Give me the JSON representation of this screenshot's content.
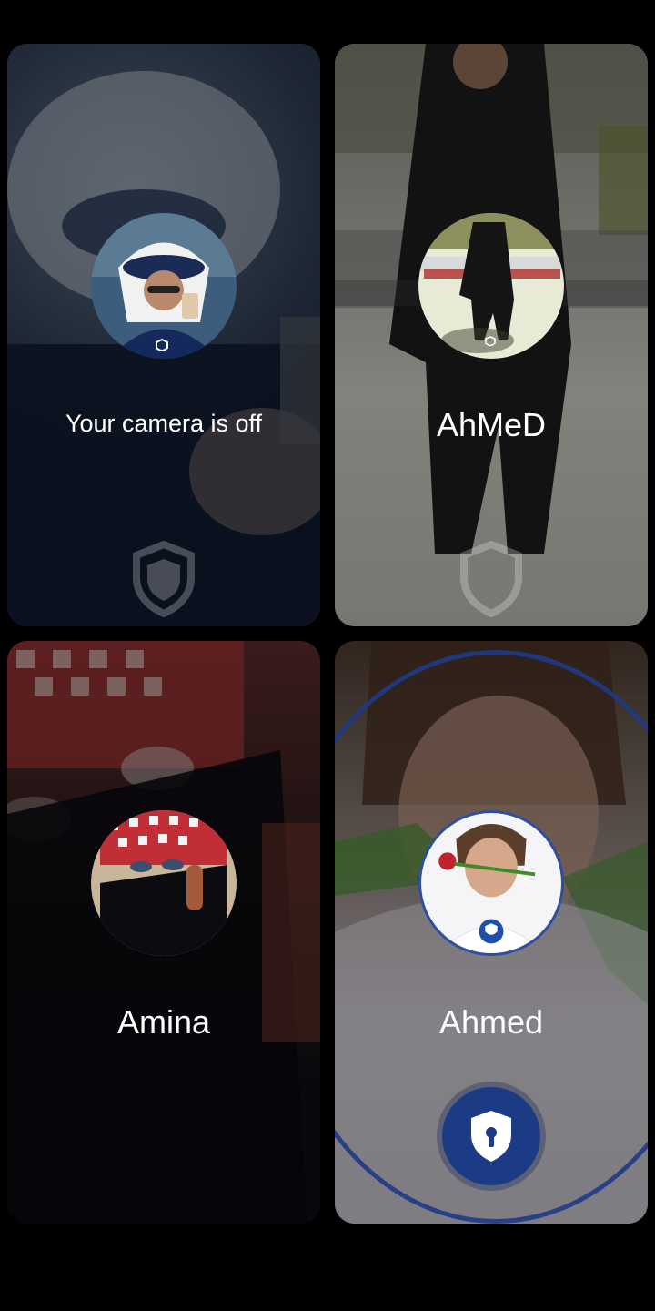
{
  "tiles": [
    {
      "label": "Your camera is off",
      "kind": "self"
    },
    {
      "label": "AhMeD",
      "kind": "remote"
    },
    {
      "label": "Amina",
      "kind": "remote"
    },
    {
      "label": "Ahmed",
      "kind": "remote-locked"
    }
  ],
  "colors": {
    "background": "#000000",
    "label": "#ffffff",
    "accent_blue": "#1b3c84"
  },
  "icons": [
    "shield-icon",
    "lock-shield-icon"
  ]
}
